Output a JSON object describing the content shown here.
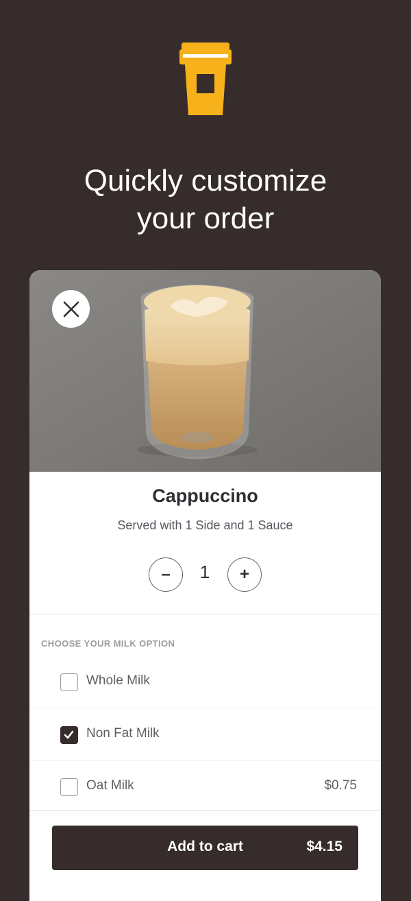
{
  "headline": {
    "line1": "Quickly customize",
    "line2": "your order"
  },
  "product": {
    "name": "Cappuccino",
    "description": "Served with 1 Side and 1 Sauce",
    "quantity": "1"
  },
  "stepper": {
    "decrease": "–",
    "increase": "+"
  },
  "milk_section": {
    "label": "CHOOSE YOUR MILK OPTION",
    "options": [
      {
        "label": "Whole Milk",
        "checked": false,
        "price": ""
      },
      {
        "label": "Non Fat Milk",
        "checked": true,
        "price": ""
      },
      {
        "label": "Oat Milk",
        "checked": false,
        "price": "$0.75"
      }
    ]
  },
  "cart": {
    "label": "Add to cart",
    "total": "$4.15"
  },
  "colors": {
    "background": "#362c2b",
    "accent": "#f7b21b",
    "button": "#362c2b"
  },
  "icons": {
    "logo": "coffee-cup-logo-icon",
    "close": "close-icon",
    "check": "checkmark-icon"
  }
}
